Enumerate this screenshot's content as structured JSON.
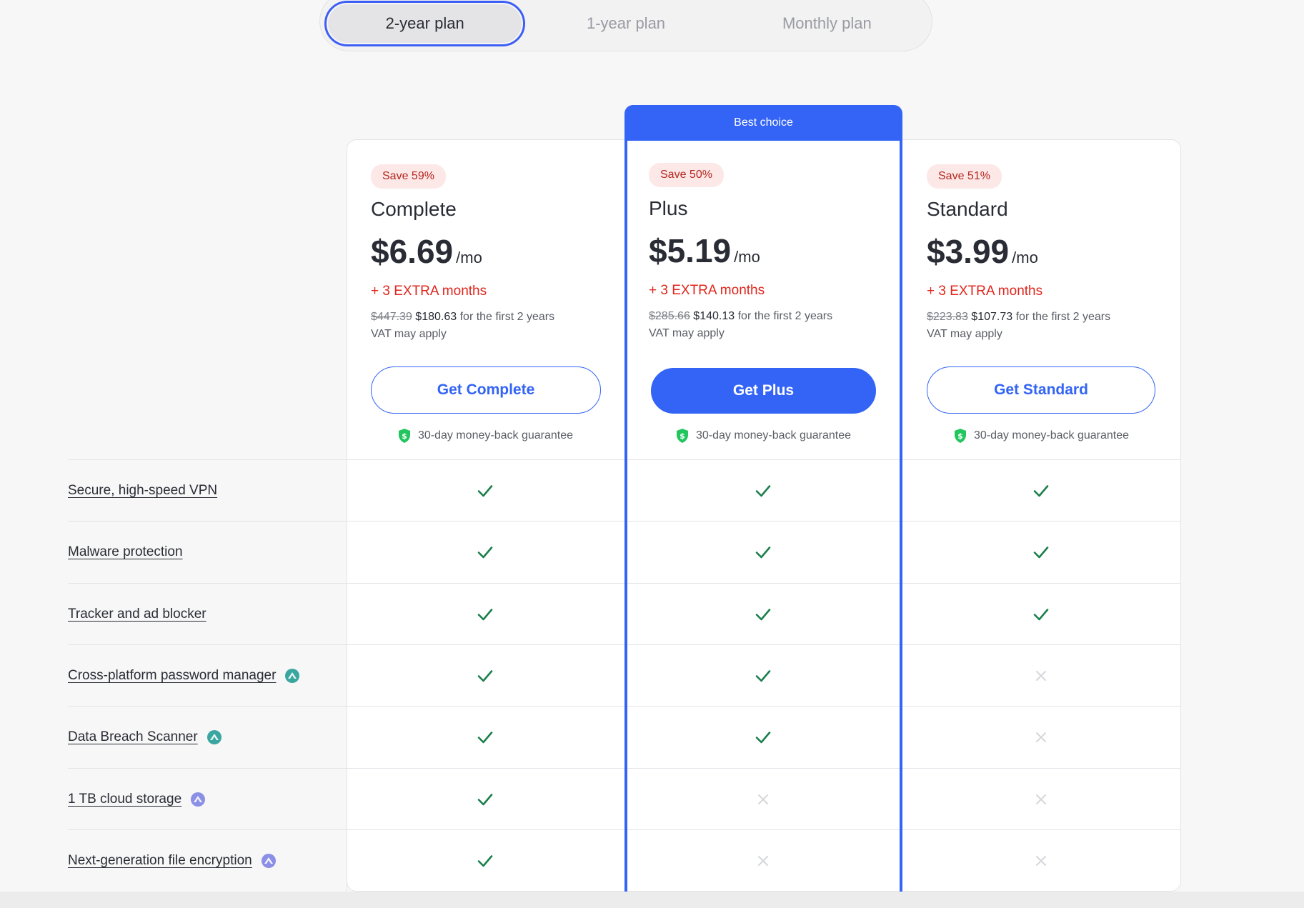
{
  "toggle": {
    "options": [
      "2-year plan",
      "1-year plan",
      "Monthly plan"
    ],
    "selected": "2-year plan"
  },
  "best_badge": "Best choice",
  "plans": [
    {
      "save": "Save 59%",
      "name": "Complete",
      "price": "$6.69",
      "per": "/mo",
      "extra": "+ 3 EXTRA months",
      "old_price": "$447.39",
      "new_price": "$180.63",
      "period": "for the first 2 years",
      "vat": "VAT may apply",
      "cta": "Get Complete",
      "guarantee": "30-day money-back guarantee"
    },
    {
      "save": "Save 50%",
      "name": "Plus",
      "price": "$5.19",
      "per": "/mo",
      "extra": "+ 3 EXTRA months",
      "old_price": "$285.66",
      "new_price": "$140.13",
      "period": "for the first 2 years",
      "vat": "VAT may apply",
      "cta": "Get Plus",
      "guarantee": "30-day money-back guarantee"
    },
    {
      "save": "Save 51%",
      "name": "Standard",
      "price": "$3.99",
      "per": "/mo",
      "extra": "+ 3 EXTRA months",
      "old_price": "$223.83",
      "new_price": "$107.73",
      "period": "for the first 2 years",
      "vat": "VAT may apply",
      "cta": "Get Standard",
      "guarantee": "30-day money-back guarantee"
    }
  ],
  "features": [
    {
      "label": "Secure, high-speed VPN",
      "badge": "",
      "included": [
        true,
        true,
        true
      ]
    },
    {
      "label": "Malware protection",
      "badge": "",
      "included": [
        true,
        true,
        true
      ]
    },
    {
      "label": "Tracker and ad blocker",
      "badge": "",
      "included": [
        true,
        true,
        true
      ]
    },
    {
      "label": "Cross-platform password manager",
      "badge": "nordpass-icon",
      "included": [
        true,
        true,
        false
      ]
    },
    {
      "label": "Data Breach Scanner",
      "badge": "nordpass-icon",
      "included": [
        true,
        true,
        false
      ]
    },
    {
      "label": "1 TB cloud storage",
      "badge": "nordlocker-icon",
      "included": [
        true,
        false,
        false
      ]
    },
    {
      "label": "Next-generation file encryption",
      "badge": "nordlocker-icon",
      "included": [
        true,
        false,
        false
      ]
    }
  ],
  "colors": {
    "accent": "#3364f5",
    "save_bg": "#fde8e8",
    "save_text": "#b3261e",
    "extra_text": "#e0261d",
    "check": "#1a7f4b",
    "cross": "#d6d7db"
  }
}
